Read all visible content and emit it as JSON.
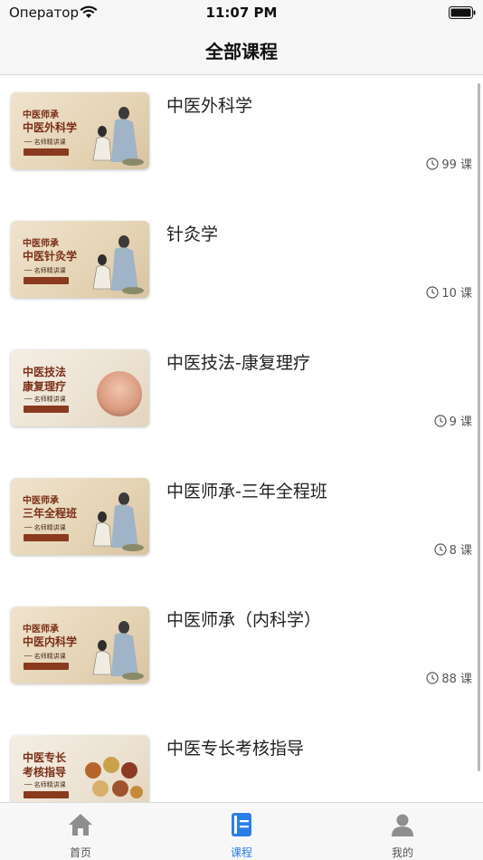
{
  "status_bar": {
    "carrier": "Оператор",
    "time": "11:07 PM"
  },
  "header": {
    "title": "全部课程"
  },
  "courses": [
    {
      "title": "中医外科学",
      "count": "99 课",
      "thumb": {
        "line1": "中医师承",
        "line2": "中医外科学",
        "sub": "── 名师精讲课"
      }
    },
    {
      "title": "针灸学",
      "count": "10 课",
      "thumb": {
        "line1": "中医师承",
        "line2": "中医针灸学",
        "sub": "── 名师精讲课"
      }
    },
    {
      "title": "中医技法-康复理疗",
      "count": "9 课",
      "thumb": {
        "line1": "中医技法",
        "line2": "康复理疗",
        "sub": "── 名师精讲课"
      }
    },
    {
      "title": "中医师承-三年全程班",
      "count": "8 课",
      "thumb": {
        "line1": "中医师承",
        "line2": "三年全程班",
        "sub": "── 名师精讲课"
      }
    },
    {
      "title": "中医师承（内科学）",
      "count": "88 课",
      "thumb": {
        "line1": "中医师承",
        "line2": "中医内科学",
        "sub": "── 名师精讲课"
      }
    },
    {
      "title": "中医专长考核指导",
      "count": "",
      "thumb": {
        "line1": "中医专长",
        "line2": "考核指导",
        "sub": "── 名师精讲课"
      }
    }
  ],
  "tabs": [
    {
      "label": "首页",
      "icon": "home-icon"
    },
    {
      "label": "课程",
      "icon": "book-icon",
      "active": true
    },
    {
      "label": "我的",
      "icon": "user-icon"
    }
  ],
  "colors": {
    "accent": "#2b7de9",
    "thumb_text": "#7a2e17"
  }
}
